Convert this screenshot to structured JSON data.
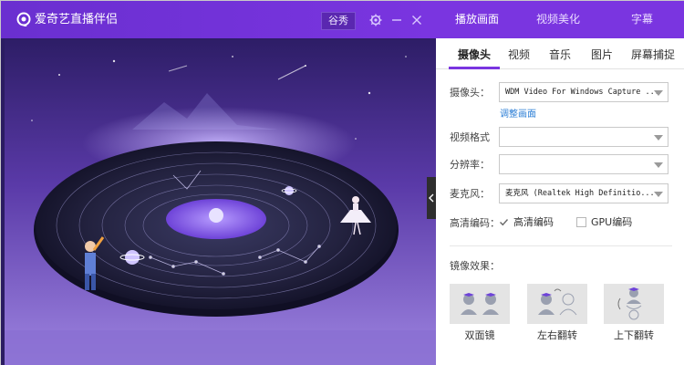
{
  "app": {
    "title": "爱奇艺直播伴侣",
    "show_button": "谷秀",
    "icons": [
      "logo-icon",
      "gear-icon",
      "minimize-icon",
      "close-icon"
    ]
  },
  "main_tabs": [
    {
      "label": "播放画面",
      "active": true
    },
    {
      "label": "视频美化",
      "active": false
    },
    {
      "label": "字幕",
      "active": false
    }
  ],
  "sub_tabs": [
    {
      "label": "摄像头",
      "active": true
    },
    {
      "label": "视频",
      "active": false
    },
    {
      "label": "音乐",
      "active": false
    },
    {
      "label": "图片",
      "active": false
    },
    {
      "label": "屏幕捕捉",
      "active": false
    }
  ],
  "form": {
    "camera": {
      "label": "摄像头：",
      "value": "WDM Video For Windows Capture ..."
    },
    "refresh_link": "调整画面",
    "format": {
      "label": "视频格式",
      "value": ""
    },
    "resolution": {
      "label": "分辨率：",
      "value": ""
    },
    "mic": {
      "label": "麦克风：",
      "value": "麦克风 (Realtek High Definitio..."
    },
    "hd_encoding": {
      "label": "高清编码：",
      "hd_option": "高清编码",
      "hd_checked": true,
      "gpu_option": "GPU编码",
      "gpu_checked": false
    }
  },
  "mirror": {
    "label": "镜像效果：",
    "options": [
      {
        "label": "双面镜"
      },
      {
        "label": "左右翻转"
      },
      {
        "label": "上下翻转"
      }
    ]
  },
  "colors": {
    "accent": "#7a35e0",
    "link": "#2d7fd6",
    "stage_bg": "#2b1c62"
  }
}
